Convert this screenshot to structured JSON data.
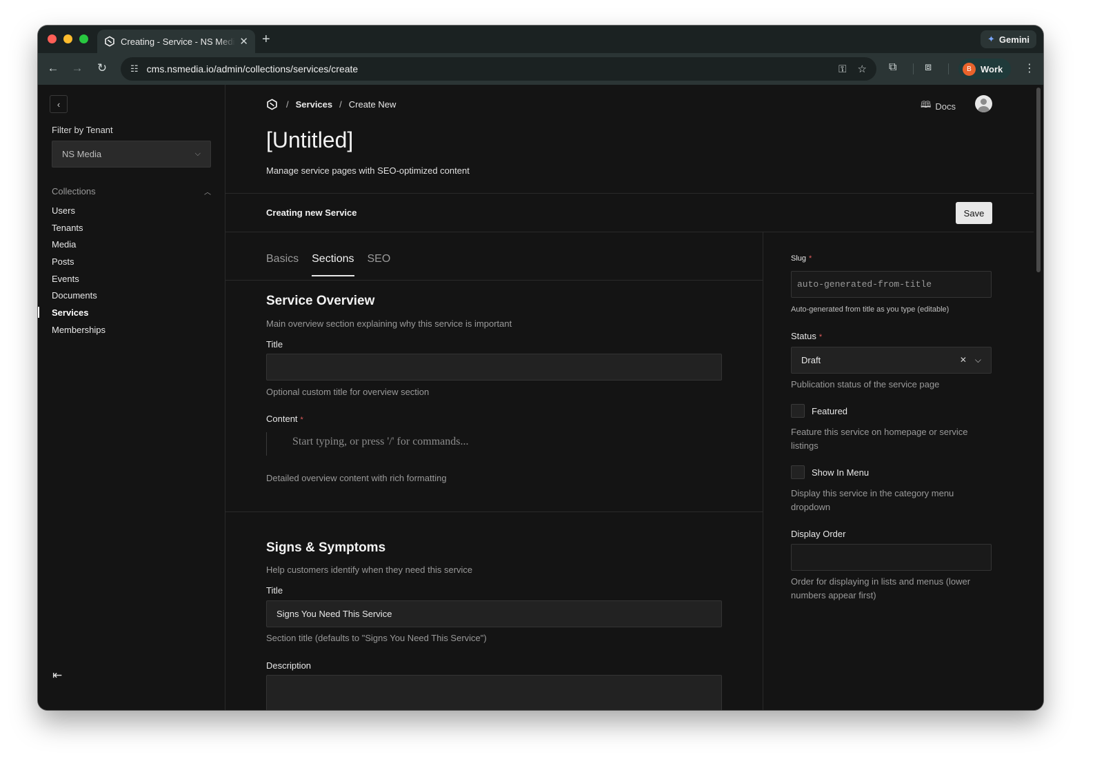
{
  "browser": {
    "tab_title": "Creating - Service - NS Media",
    "url": "cms.nsmedia.io/admin/collections/services/create",
    "gemini_label": "Gemini",
    "profile_initial": "B",
    "profile_label": "Work"
  },
  "sidebar": {
    "filter_label": "Filter by Tenant",
    "tenant_value": "NS Media",
    "collections_label": "Collections",
    "items": [
      {
        "label": "Users"
      },
      {
        "label": "Tenants"
      },
      {
        "label": "Media"
      },
      {
        "label": "Posts"
      },
      {
        "label": "Events"
      },
      {
        "label": "Documents"
      },
      {
        "label": "Services",
        "active": true
      },
      {
        "label": "Memberships"
      }
    ]
  },
  "header": {
    "breadcrumb_services": "Services",
    "breadcrumb_current": "Create New",
    "docs_label": "Docs",
    "title": "[Untitled]",
    "description": "Manage service pages with SEO-optimized content"
  },
  "editbar": {
    "status": "Creating new Service",
    "save_label": "Save"
  },
  "tabs": [
    {
      "label": "Basics",
      "active": false
    },
    {
      "label": "Sections",
      "active": true
    },
    {
      "label": "SEO",
      "active": false
    }
  ],
  "overview": {
    "title": "Service Overview",
    "description": "Main overview section explaining why this service is important",
    "title_label": "Title",
    "title_value": "",
    "title_helper": "Optional custom title for overview section",
    "content_label": "Content",
    "content_placeholder": "Start typing, or press '/' for commands...",
    "content_helper": "Detailed overview content with rich formatting"
  },
  "signs": {
    "title": "Signs & Symptoms",
    "description": "Help customers identify when they need this service",
    "title_label": "Title",
    "title_value": "Signs You Need This Service",
    "title_helper": "Section title (defaults to \"Signs You Need This Service\")",
    "description_label": "Description"
  },
  "side": {
    "slug_label": "Slug",
    "slug_placeholder": "auto-generated-from-title",
    "slug_helper": "Auto-generated from title as you type (editable)",
    "status_label": "Status",
    "status_value": "Draft",
    "status_helper": "Publication status of the service page",
    "featured_label": "Featured",
    "featured_checked": false,
    "featured_helper": "Feature this service on homepage or service listings",
    "menu_label": "Show In Menu",
    "menu_checked": false,
    "menu_helper": "Display this service in the category menu dropdown",
    "order_label": "Display Order",
    "order_value": "",
    "order_helper": "Order for displaying in lists and menus (lower numbers appear first)"
  }
}
